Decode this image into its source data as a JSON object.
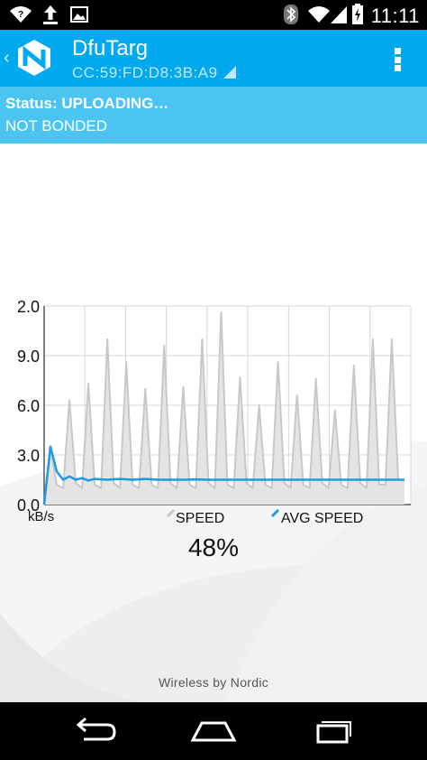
{
  "status_bar": {
    "time": "11:11",
    "icons": [
      "wifi-question-icon",
      "upload-icon",
      "image-icon",
      "bluetooth-icon",
      "wifi-icon",
      "cell-signal-icon",
      "battery-charging-icon"
    ]
  },
  "action_bar": {
    "title": "DfuTarg",
    "subtitle": "CC:59:FD:D8:3B:A9",
    "accent": "#00A9EE"
  },
  "status_panel": {
    "status": "Status: UPLOADING…",
    "bond": "NOT BONDED",
    "color": "#4BC4F2"
  },
  "chart_data": {
    "type": "line",
    "ylabel": "kB/s",
    "ytick_labels": [
      "0.0",
      "3.0",
      "6.0",
      "9.0",
      "2.0"
    ],
    "ylim": [
      0,
      12
    ],
    "xlim": [
      0,
      29
    ],
    "grid": true,
    "legend": "bottom",
    "series": [
      {
        "name": "SPEED",
        "color": "#c8c8c8",
        "style": "area",
        "x": [
          0,
          0.5,
          1,
          1.5,
          2,
          2.5,
          3,
          3.5,
          4,
          4.5,
          5,
          5.5,
          6,
          6.5,
          7,
          7.5,
          8,
          8.5,
          9,
          9.5,
          10,
          10.5,
          11,
          11.5,
          12,
          12.5,
          13,
          13.5,
          14,
          14.5,
          15,
          15.5,
          16,
          16.5,
          17,
          17.5,
          18,
          18.5,
          19,
          19.5,
          20,
          20.5,
          21,
          21.5,
          22,
          22.5,
          23,
          23.5,
          24,
          24.5,
          25,
          25.5,
          26,
          26.5,
          27,
          27.5,
          28,
          28.5
        ],
        "values": [
          0,
          3.4,
          1.2,
          1.0,
          6.3,
          1.3,
          1.0,
          7.3,
          1.2,
          1.0,
          10.0,
          1.3,
          1.0,
          8.6,
          1.2,
          1.0,
          7.0,
          1.2,
          1.0,
          9.6,
          1.3,
          1.0,
          7.1,
          1.2,
          1.0,
          10.0,
          1.3,
          1.0,
          11.6,
          1.2,
          1.0,
          7.7,
          1.3,
          1.0,
          6.0,
          1.2,
          1.0,
          8.6,
          1.3,
          1.0,
          6.6,
          1.2,
          1.0,
          7.6,
          1.3,
          1.0,
          5.7,
          1.2,
          1.0,
          8.4,
          1.3,
          1.0,
          10.0,
          1.2,
          1.2,
          10.0,
          1.5,
          1.5
        ]
      },
      {
        "name": "AVG SPEED",
        "color": "#1E9BE0",
        "style": "line",
        "x": [
          0,
          0.5,
          1,
          1.5,
          2,
          2.5,
          3,
          3.5,
          4,
          5,
          6,
          7,
          8,
          9,
          10,
          11,
          12,
          13,
          14,
          15,
          16,
          17,
          18,
          19,
          20,
          21,
          22,
          23,
          24,
          25,
          26,
          27,
          28,
          28.5
        ],
        "values": [
          0,
          3.5,
          2.0,
          1.5,
          1.7,
          1.5,
          1.6,
          1.45,
          1.55,
          1.5,
          1.55,
          1.5,
          1.55,
          1.5,
          1.5,
          1.5,
          1.52,
          1.5,
          1.5,
          1.5,
          1.5,
          1.5,
          1.5,
          1.5,
          1.5,
          1.5,
          1.5,
          1.5,
          1.5,
          1.5,
          1.5,
          1.5,
          1.5,
          1.5
        ]
      }
    ]
  },
  "progress": {
    "label": "48%",
    "value": 48
  },
  "footer": {
    "text": "Wireless by Nordic"
  },
  "nav_bar": {
    "icons": [
      "back-icon",
      "home-icon",
      "recents-icon"
    ]
  }
}
